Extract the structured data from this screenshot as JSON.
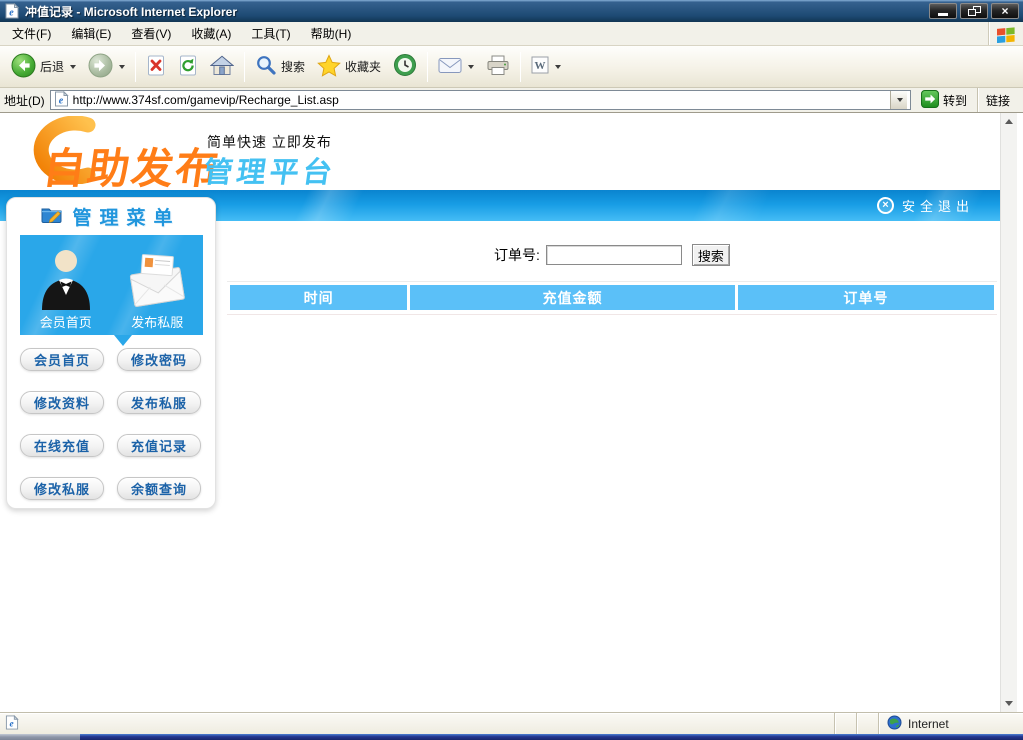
{
  "window": {
    "title": "冲值记录 - Microsoft Internet Explorer"
  },
  "menubar": {
    "items": [
      "文件(F)",
      "编辑(E)",
      "查看(V)",
      "收藏(A)",
      "工具(T)",
      "帮助(H)"
    ]
  },
  "toolbar": {
    "back_label": "后退",
    "search_label": "搜索",
    "favorites_label": "收藏夹",
    "icons": [
      "back-icon",
      "forward-icon",
      "stop-icon",
      "refresh-icon",
      "home-icon",
      "search-icon",
      "favorites-star-icon",
      "history-icon",
      "mail-icon",
      "print-icon",
      "word-edit-icon"
    ]
  },
  "addressbar": {
    "label": "地址(D)",
    "url": "http://www.374sf.com/gamevip/Recharge_List.asp",
    "go_label": "转到",
    "links_label": "链接"
  },
  "page": {
    "logo": {
      "main": "自助发布",
      "tagline": "简单快速 立即发布",
      "subtitle": "管理平台"
    },
    "topbar": {
      "logout_label": "安全退出"
    },
    "menu": {
      "title": "管理菜单",
      "featured": [
        {
          "icon": "member-avatar-icon",
          "label": "会员首页"
        },
        {
          "icon": "publish-envelope-icon",
          "label": "发布私服"
        }
      ],
      "buttons": [
        "会员首页",
        "修改密码",
        "修改资料",
        "发布私服",
        "在线充值",
        "充值记录",
        "修改私服",
        "余额查询"
      ]
    },
    "search": {
      "label": "订单号:",
      "value": "",
      "button_label": "搜索"
    },
    "table": {
      "headers": [
        "时间",
        "充值金额",
        "订单号"
      ],
      "rows": []
    }
  },
  "statusbar": {
    "right_label": "Internet"
  },
  "colors": {
    "brand_orange": "#ff7d17",
    "brand_cyan": "#44c1f2",
    "topbar_blue": "#179ce4",
    "panel_blue": "#2aa7e9",
    "table_header_blue": "#5bc0f8",
    "menu_text_blue": "#1b62a8"
  }
}
